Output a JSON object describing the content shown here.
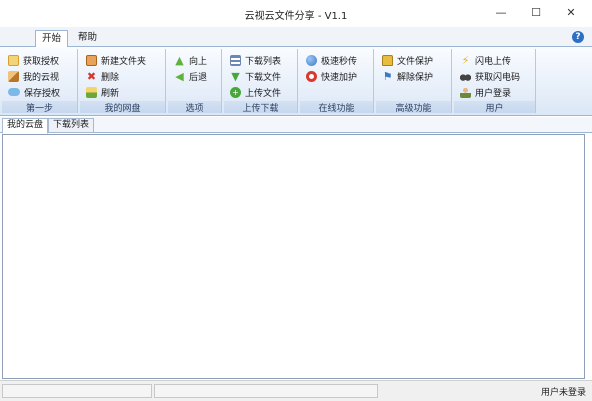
{
  "window": {
    "title": "云视云文件分享 - V1.1",
    "minimize": "—",
    "maximize": "☐",
    "close": "✕"
  },
  "menubar": {
    "tabs": [
      {
        "label": "开始",
        "active": true
      },
      {
        "label": "帮助",
        "active": false
      }
    ],
    "help_icon": "?"
  },
  "ribbon": {
    "groups": [
      {
        "label": "第一步",
        "items": [
          {
            "label": "获取授权",
            "icon": "key-icon",
            "color": "#d8a02a"
          },
          {
            "label": "我的云视",
            "icon": "pencil-icon",
            "color": "#e0a64a"
          },
          {
            "label": "保存授权",
            "icon": "cloud-icon",
            "color": "#5aa2dc"
          }
        ]
      },
      {
        "label": "我的网盘",
        "items": [
          {
            "label": "新建文件夹",
            "icon": "folder-icon",
            "color": "#c87a2e"
          },
          {
            "label": "删除",
            "icon": "delete-icon",
            "color": "#d8362c"
          },
          {
            "label": "刷新",
            "icon": "refresh-icon",
            "color": "#6aa83c"
          }
        ]
      },
      {
        "label": "选项",
        "items": [
          {
            "label": "向上",
            "icon": "arrow-up-icon",
            "color": "#5db33b"
          },
          {
            "label": "后退",
            "icon": "arrow-left-icon",
            "color": "#5db33b"
          }
        ]
      },
      {
        "label": "上传下载",
        "items": [
          {
            "label": "下载列表",
            "icon": "list-icon",
            "color": "#6b87b3"
          },
          {
            "label": "下载文件",
            "icon": "download-icon",
            "color": "#49a63b"
          },
          {
            "label": "上传文件",
            "icon": "upload-icon",
            "color": "#49a63b"
          }
        ]
      },
      {
        "label": "在线功能",
        "items": [
          {
            "label": "极速秒传",
            "icon": "globe-icon",
            "color": "#3b78c8"
          },
          {
            "label": "快速加护",
            "icon": "lifebuoy-icon",
            "color": "#d83a30"
          }
        ]
      },
      {
        "label": "高级功能",
        "items": [
          {
            "label": "文件保护",
            "icon": "lock-icon",
            "color": "#d8a02a"
          },
          {
            "label": "解除保护",
            "icon": "flag-icon",
            "color": "#3b78c8"
          }
        ]
      },
      {
        "label": "用户",
        "items": [
          {
            "label": "闪电上传",
            "icon": "lightning-icon",
            "color": "#e8b21c"
          },
          {
            "label": "获取闪电码",
            "icon": "binoculars-icon",
            "color": "#444444"
          },
          {
            "label": "用户登录",
            "icon": "user-icon",
            "color": "#6a8a3a"
          }
        ]
      }
    ]
  },
  "content_tabs": [
    {
      "label": "我的云盘",
      "active": true
    },
    {
      "label": "下载列表",
      "active": false
    }
  ],
  "statusbar": {
    "text": "用户未登录"
  }
}
